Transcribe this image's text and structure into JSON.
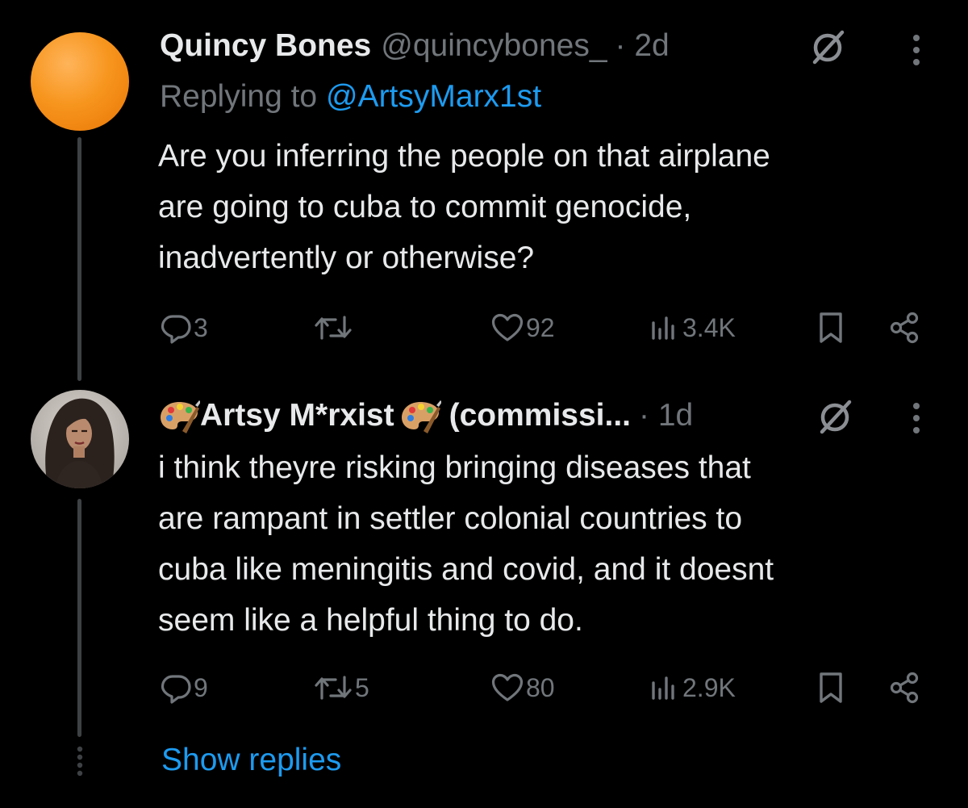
{
  "colors": {
    "background": "#000000",
    "text": "#e7e9ea",
    "muted": "#71767b",
    "link": "#1d9bf0",
    "thread_line": "#3e4144",
    "quincy_avatar": "#f7961f"
  },
  "tweets": [
    {
      "display_name": "Quincy Bones",
      "handle": "@quincybones_",
      "time": "· 2d",
      "replying_prefix": "Replying to",
      "replying_to": "@ArtsyMarx1st",
      "text_lines": [
        "Are you inferring the people on that airplane",
        "are going to cuba to commit genocide,",
        "inadvertently or otherwise?"
      ],
      "replies": "3",
      "retweets": "",
      "likes": "92",
      "views": "3.4K",
      "icons": [
        "grok-icon",
        "more-icon",
        "reply-icon",
        "retweet-icon",
        "like-icon",
        "views-icon",
        "bookmark-icon",
        "share-icon"
      ]
    },
    {
      "display_name_prefix_emoji": "🎨",
      "display_name": "Artsy M*rxist",
      "display_name_mid_emoji": "🎨",
      "display_name_suffix": "(commissi...",
      "time": "· 1d",
      "text_lines": [
        "i think theyre risking bringing diseases that",
        "are rampant in settler colonial countries to",
        "cuba like meningitis and covid, and it doesnt",
        "seem like a helpful thing to do."
      ],
      "replies": "9",
      "retweets": "5",
      "likes": "80",
      "views": "2.9K"
    }
  ],
  "show_replies": "Show replies"
}
